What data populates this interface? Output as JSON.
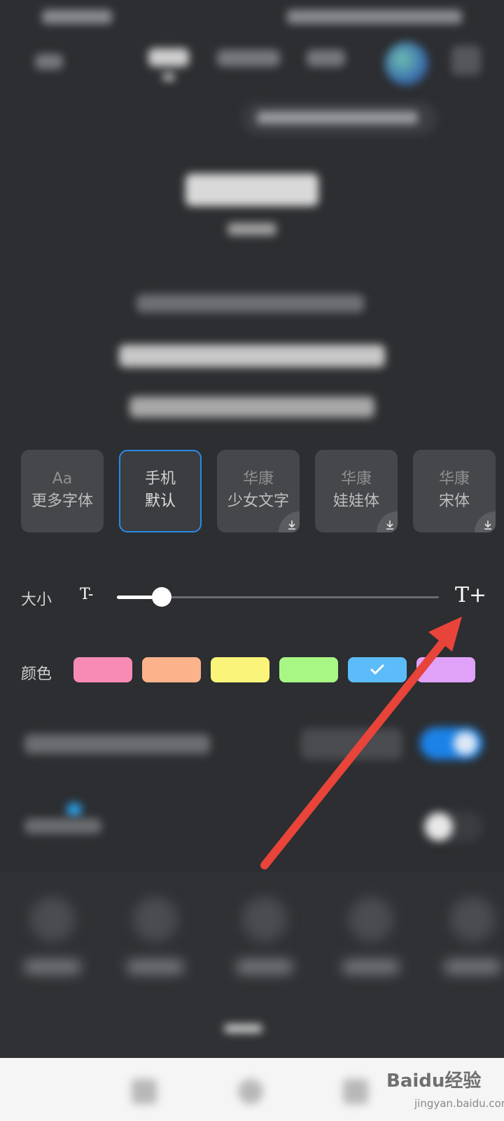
{
  "font_cards": [
    {
      "line1": "Aa",
      "line2": "更多字体",
      "selected": false,
      "downloadable": false
    },
    {
      "line1": "手机",
      "line2": "默认",
      "selected": true,
      "downloadable": false
    },
    {
      "line1": "华康",
      "line2": "少女文字",
      "selected": false,
      "downloadable": true
    },
    {
      "line1": "华康",
      "line2": "娃娃体",
      "selected": false,
      "downloadable": true
    },
    {
      "line1": "华康",
      "line2": "宋体",
      "selected": false,
      "downloadable": true
    }
  ],
  "size": {
    "label": "大小",
    "decrease_label": "T-",
    "increase_label": "T+",
    "value_fraction": 0.14
  },
  "color": {
    "label": "颜色",
    "swatches": [
      "#f88bb3",
      "#fcb38b",
      "#fbf47a",
      "#a8f785",
      "#5bbcf9",
      "#e0a2f9"
    ],
    "selected_index": 4
  },
  "colors_ui": {
    "accent": "#2b8be6",
    "annotation_arrow": "#e8443a"
  },
  "watermark": {
    "logo": "Baidu经验",
    "url": "jingyan.baidu.com"
  }
}
